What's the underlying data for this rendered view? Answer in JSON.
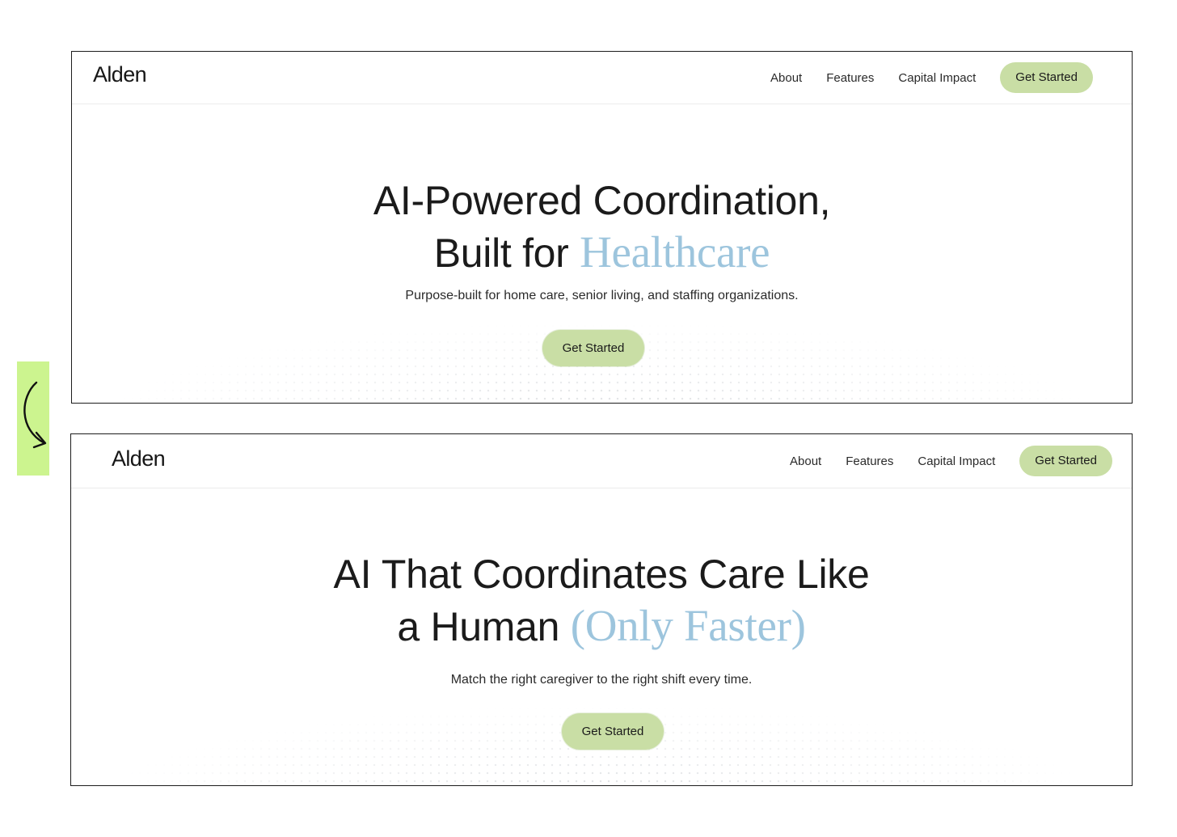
{
  "before": {
    "logo": "Alden",
    "nav": {
      "links": [
        "About",
        "Features",
        "Capital Impact"
      ],
      "cta": "Get Started"
    },
    "hero": {
      "title_line1": "AI-Powered Coordination,",
      "title_line2_plain": "Built for ",
      "title_line2_accent": "Healthcare",
      "subtitle": "Purpose-built for home care, senior living, and staffing organizations.",
      "cta": "Get Started"
    }
  },
  "after": {
    "logo": "Alden",
    "nav": {
      "links": [
        "About",
        "Features",
        "Capital Impact"
      ],
      "cta": "Get Started"
    },
    "hero": {
      "title_line1": "AI That Coordinates Care Like",
      "title_line2_plain": "a Human ",
      "title_line2_accent": "(Only Faster)",
      "subtitle": "Match the right caregiver to the right shift every time.",
      "cta": "Get Started"
    }
  },
  "annotation": {
    "icon": "curved-arrow-down-right-icon",
    "highlight_color": "#ccf48f"
  },
  "colors": {
    "accent_text": "#9dc5dd",
    "cta_background": "#c9dea5",
    "frame_border": "#1c1c1c"
  }
}
